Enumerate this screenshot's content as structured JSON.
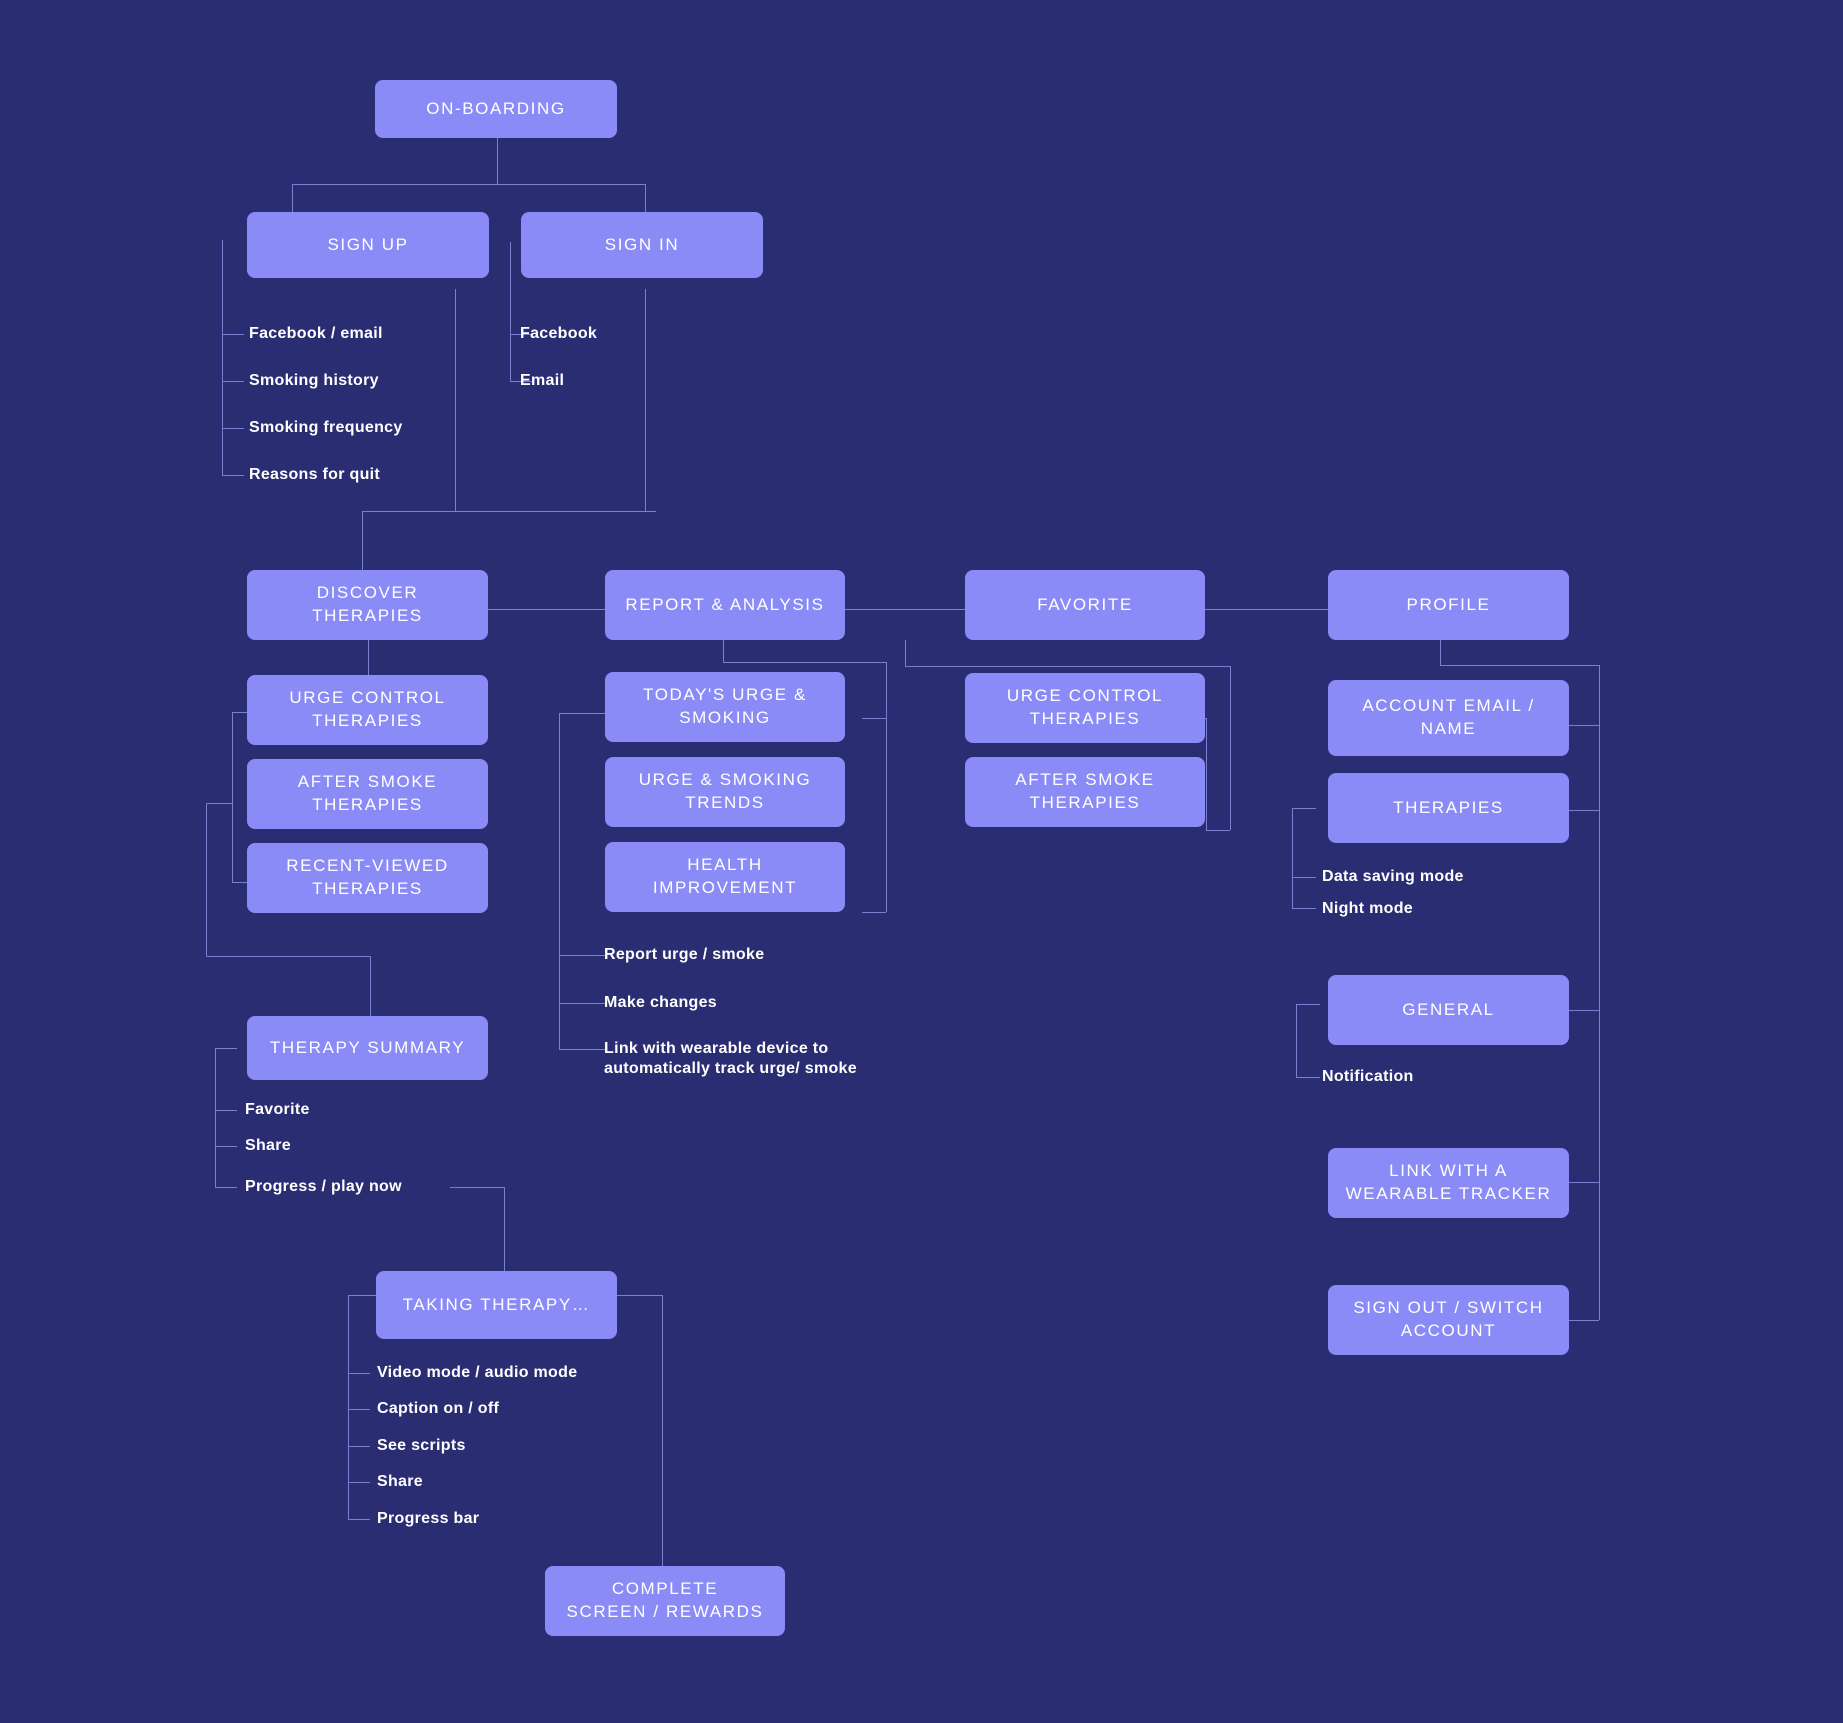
{
  "meta": {
    "title": "Quit Smoking App Sitemap",
    "colors": {
      "background": "#2b2d73",
      "node": "#8b8bf7",
      "node_text": "#ffffff",
      "connector": "#7a7fd0",
      "leaf_text": "#ffffff"
    }
  },
  "nodes": {
    "onboarding": "ON-BOARDING",
    "sign_up": "SIGN UP",
    "sign_in": "SIGN IN",
    "discover_therapies": "DISCOVER\nTHERAPIES",
    "report_analysis": "REPORT & ANALYSIS",
    "favorite": "FAVORITE",
    "profile": "PROFILE",
    "urge_control_therapies_1": "URGE CONTROL\nTHERAPIES",
    "after_smoke_therapies_1": "AFTER SMOKE\nTHERAPIES",
    "recent_viewed_therapies": "RECENT-VIEWED\nTHERAPIES",
    "todays_urge_smoking": "TODAY'S URGE &\nSMOKING",
    "urge_smoking_trends": "URGE & SMOKING\nTRENDS",
    "health_improvement": "HEALTH\nIMPROVEMENT",
    "urge_control_therapies_2": "URGE CONTROL\nTHERAPIES",
    "after_smoke_therapies_2": "AFTER SMOKE\nTHERAPIES",
    "account_email_name": "ACCOUNT EMAIL /\nNAME",
    "therapies": "THERAPIES",
    "general": "GENERAL",
    "link_wearable_tracker": "LINK WITH A\nWEARABLE TRACKER",
    "sign_out_switch_account": "SIGN OUT / SWITCH\nACCOUNT",
    "therapy_summary": "THERAPY SUMMARY",
    "taking_therapy": "TAKING THERAPY…",
    "complete_screen_rewards": "COMPLETE\nSCREEN / REWARDS"
  },
  "leaves": {
    "sign_up_items": [
      "Facebook / email",
      "Smoking history",
      "Smoking frequency",
      "Reasons for quit"
    ],
    "sign_in_items": [
      "Facebook",
      "Email"
    ],
    "report_items": [
      "Report urge / smoke",
      "Make changes",
      "Link with wearable device to\nautomatically track urge/ smoke"
    ],
    "therapies_items": [
      "Data saving mode",
      "Night mode"
    ],
    "general_items": [
      "Notification"
    ],
    "therapy_summary_items": [
      "Favorite",
      "Share",
      "Progress / play now"
    ],
    "taking_therapy_items": [
      "Video mode / audio mode",
      "Caption on / off",
      "See scripts",
      "Share",
      "Progress bar"
    ]
  }
}
